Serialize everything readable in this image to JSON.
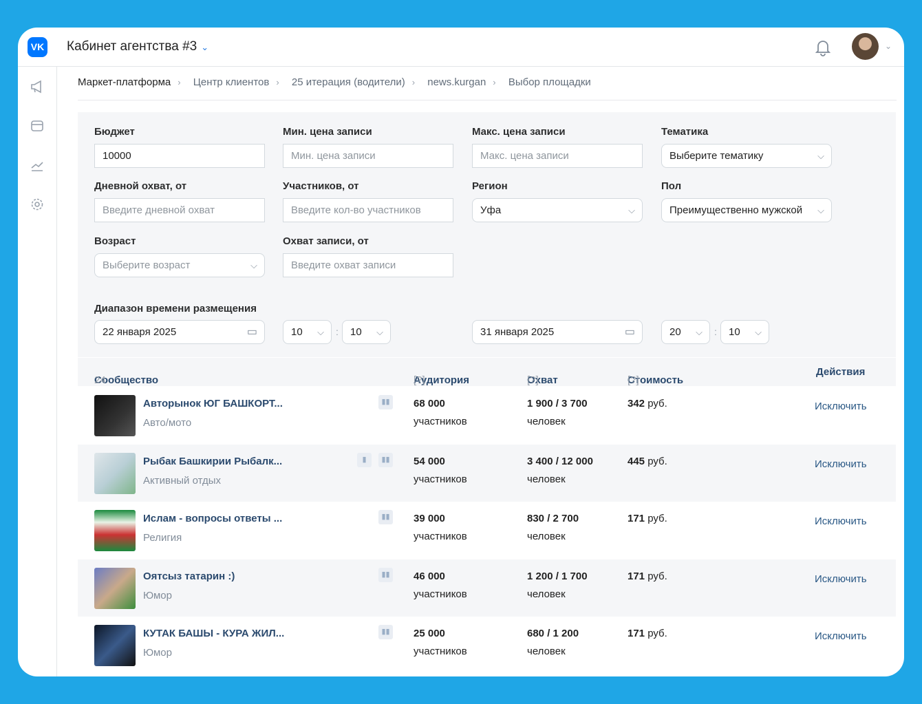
{
  "header": {
    "logo": "VK",
    "title": "Кабинет агентства #3"
  },
  "breadcrumbs": [
    "Маркет-платформа",
    "Центр клиентов",
    "25 итерация (водители)",
    "news.kurgan",
    "Выбор площадки"
  ],
  "filters": {
    "budget": {
      "label": "Бюджет",
      "value": "10000"
    },
    "min_price": {
      "label": "Мин. цена записи",
      "placeholder": "Мин. цена записи"
    },
    "max_price": {
      "label": "Макс. цена записи",
      "placeholder": "Макс. цена записи"
    },
    "topic": {
      "label": "Тематика",
      "value": "Выберите тематику"
    },
    "daily_reach": {
      "label": "Дневной охват, от",
      "placeholder": "Введите дневной охват"
    },
    "members": {
      "label": "Участников, от",
      "placeholder": "Введите кол-во участников"
    },
    "region": {
      "label": "Регион",
      "value": "Уфа"
    },
    "gender": {
      "label": "Пол",
      "value": "Преимущественно мужской"
    },
    "age": {
      "label": "Возраст",
      "placeholder": "Выберите возраст"
    },
    "post_reach": {
      "label": "Охват записи, от",
      "placeholder": "Введите охват записи"
    },
    "time_range": {
      "label": "Диапазон времени размещения",
      "start_date": "22 января 2025",
      "start_hour": "10",
      "start_min": "10",
      "end_date": "31 января 2025",
      "end_hour": "20",
      "end_min": "10"
    }
  },
  "table": {
    "headers": {
      "community": "Сообщество",
      "count": "24",
      "audience": "Аудитория",
      "reach": "Охват",
      "cost": "Стоимость",
      "help": "[?]",
      "actions": "Действия"
    },
    "rows": [
      {
        "name": "Авторынок ЮГ БАШКОРТ...",
        "category": "Авто/мото",
        "audience": "68 000",
        "audience_unit": "участников",
        "reach": "1 900 / 3 700",
        "reach_unit": "человек",
        "cost": "342",
        "currency": "руб.",
        "action": "Исключить"
      },
      {
        "name": "Рыбак Башкирии Рыбалк...",
        "category": "Активный отдых",
        "audience": "54 000",
        "audience_unit": "участников",
        "reach": "3 400 / 12 000",
        "reach_unit": "человек",
        "cost": "445",
        "currency": "руб.",
        "action": "Исключить"
      },
      {
        "name": "Ислам - вопросы ответы ...",
        "category": "Религия",
        "audience": "39 000",
        "audience_unit": "участников",
        "reach": "830 / 2 700",
        "reach_unit": "человек",
        "cost": "171",
        "currency": "руб.",
        "action": "Исключить"
      },
      {
        "name": "Оятсыз татарин :)",
        "category": "Юмор",
        "audience": "46 000",
        "audience_unit": "участников",
        "reach": "1 200 / 1 700",
        "reach_unit": "человек",
        "cost": "171",
        "currency": "руб.",
        "action": "Исключить"
      },
      {
        "name": "КУТАК БАШЫ - КУРА ЖИЛ...",
        "category": "Юмор",
        "audience": "25 000",
        "audience_unit": "участников",
        "reach": "680 / 1 200",
        "reach_unit": "человек",
        "cost": "171",
        "currency": "руб.",
        "action": "Исключить"
      }
    ]
  }
}
